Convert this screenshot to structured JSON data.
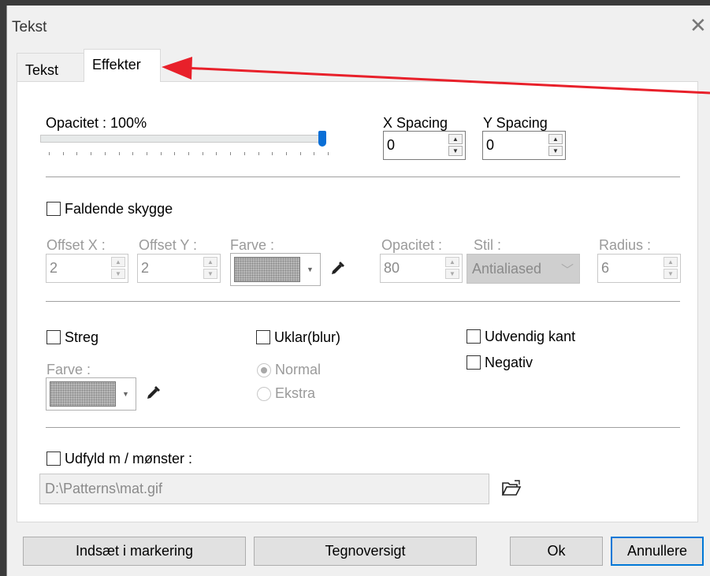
{
  "window": {
    "title": "Tekst",
    "close_icon": "close-icon"
  },
  "tabs": [
    {
      "label": "Tekst",
      "active": false
    },
    {
      "label": "Effekter",
      "active": true
    }
  ],
  "opacity": {
    "label": "Opacitet : 100%",
    "value_percent": 100
  },
  "spacing": {
    "x_label": "X Spacing",
    "x_value": "0",
    "y_label": "Y Spacing",
    "y_value": "0"
  },
  "drop_shadow": {
    "checkbox_label": "Faldende skygge",
    "checked": false,
    "offset_x_label": "Offset X :",
    "offset_x_value": "2",
    "offset_y_label": "Offset Y :",
    "offset_y_value": "2",
    "color_label": "Farve :",
    "opacity_label": "Opacitet :",
    "opacity_value": "80",
    "style_label": "Stil :",
    "style_value": "Antialiased",
    "radius_label": "Radius :",
    "radius_value": "6"
  },
  "stroke": {
    "checkbox_label": "Streg",
    "checked": false,
    "color_label": "Farve :"
  },
  "blur": {
    "checkbox_label": "Uklar(blur)",
    "checked": false,
    "option_normal": "Normal",
    "option_extra": "Ekstra",
    "selected": "Normal"
  },
  "outer_edge": {
    "checkbox_label": "Udvendig kant",
    "checked": false
  },
  "negative": {
    "checkbox_label": "Negativ",
    "checked": false
  },
  "pattern_fill": {
    "checkbox_label": "Udfyld m / mønster :",
    "checked": false,
    "path": "D:\\Patterns\\mat.gif"
  },
  "buttons": {
    "insert": "Indsæt i markering",
    "charmap": "Tegnoversigt",
    "ok": "Ok",
    "cancel": "Annullere"
  },
  "colors": {
    "accent": "#0078d7",
    "annotation_arrow": "#e8202a",
    "slider_thumb": "#0a6fd6"
  }
}
